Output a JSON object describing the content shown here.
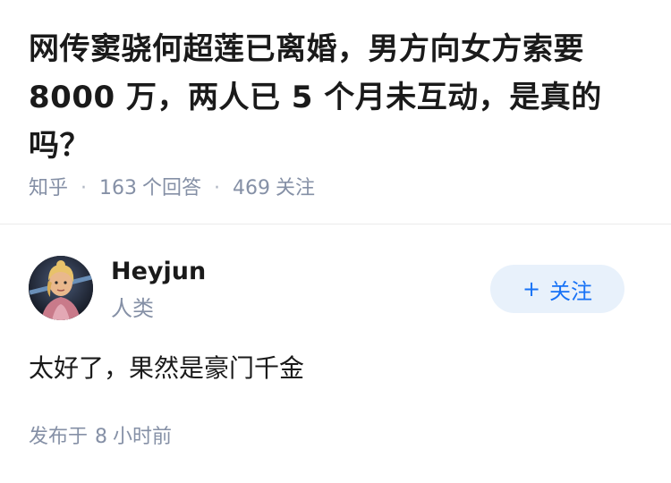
{
  "question": {
    "title": "网传窦骁何超莲已离婚，男方向女方索要 8000 万，两人已 5 个月未互动，是真的吗？",
    "source": "知乎",
    "answer_count": "163",
    "answer_count_label": "个回答",
    "follower_count": "469",
    "follower_count_label": "关注"
  },
  "answer": {
    "author": {
      "name": "Heyjun",
      "headline": "人类",
      "avatar_icon": "cartoon-character-avatar"
    },
    "follow_button": {
      "plus": "+",
      "label": "关注"
    },
    "content": "太好了，果然是豪门千金",
    "published_prefix": "发布于",
    "published_value": "8",
    "published_suffix": "小时前"
  },
  "colors": {
    "text_primary": "#1a1a1a",
    "text_secondary": "#8590a6",
    "accent": "#1772f6",
    "button_bg": "#e8f1fb",
    "divider": "#ebebeb"
  }
}
